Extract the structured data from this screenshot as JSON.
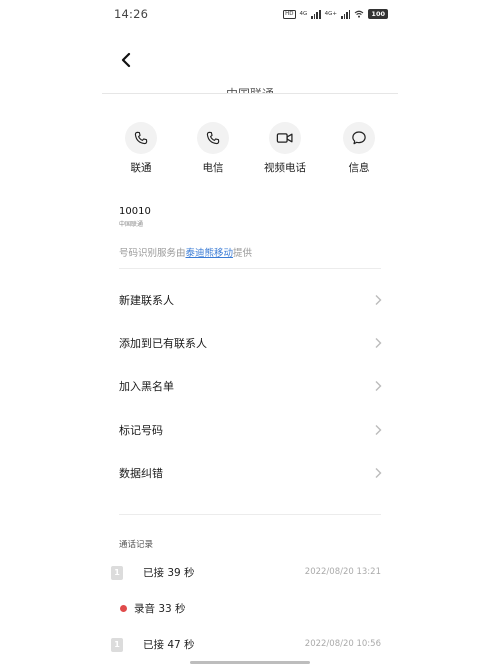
{
  "status_bar": {
    "time": "14:26",
    "hd_label": "HD",
    "net1": "4G",
    "net2": "4G+",
    "battery": "100"
  },
  "header": {
    "title": "中国联通"
  },
  "actions": [
    {
      "label": "联通",
      "icon": "phone-icon"
    },
    {
      "label": "电信",
      "icon": "phone-icon"
    },
    {
      "label": "视频电话",
      "icon": "video-icon"
    },
    {
      "label": "信息",
      "icon": "message-icon"
    }
  ],
  "contact": {
    "number": "10010",
    "carrier": "中国联通",
    "provider_prefix": "号码识别服务由",
    "provider_link": "泰迪熊移动",
    "provider_suffix": "提供"
  },
  "menu": [
    {
      "label": "新建联系人"
    },
    {
      "label": "添加到已有联系人"
    },
    {
      "label": "加入黑名单"
    },
    {
      "label": "标记号码"
    },
    {
      "label": "数据纠错"
    }
  ],
  "call_log": {
    "title": "通话记录",
    "sim_label": "1",
    "entries": [
      {
        "text": "已接 39 秒",
        "time": "2022/08/20  13:21"
      },
      {
        "text": "录音 33 秒",
        "time": ""
      },
      {
        "text": "已接 47 秒",
        "time": "2022/08/20  10:56"
      }
    ]
  },
  "colors": {
    "accent_link": "#3a7bd5",
    "recording_dot": "#e04b4b"
  }
}
